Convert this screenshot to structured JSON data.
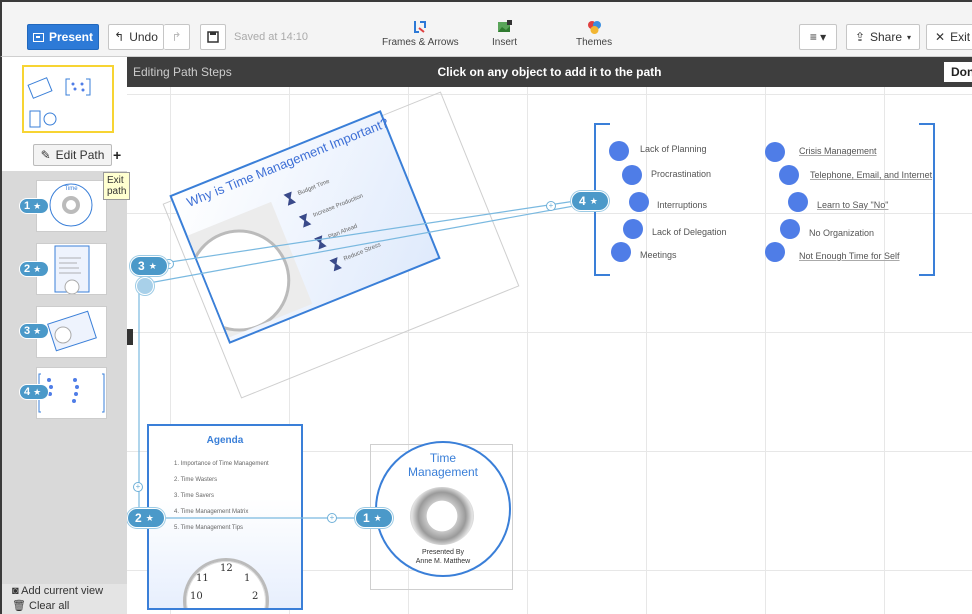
{
  "toolbar": {
    "present_label": "Present",
    "undo_label": "Undo",
    "saved_text": "Saved at 14:10",
    "frames_label": "Frames & Arrows",
    "insert_label": "Insert",
    "themes_label": "Themes",
    "menu_label": "≡ ▾",
    "share_label": "Share",
    "exit_label": "Exit"
  },
  "sidebar": {
    "edit_path_label": "Edit Path",
    "tooltip": "Exit path",
    "thumbnails": [
      {
        "number": "1"
      },
      {
        "number": "2"
      },
      {
        "number": "3"
      },
      {
        "number": "4"
      }
    ],
    "add_view_label": "Add current view",
    "clear_label": "Clear all"
  },
  "pathbar": {
    "left_text": "Editing Path Steps",
    "center_text": "Click on any object to add it to the path",
    "done_label": "Don"
  },
  "slide3": {
    "title": "Why is Time Management Important?",
    "bullets": [
      "Budget Time",
      "Increase Production",
      "Plan Ahead",
      "Reduce Stress"
    ]
  },
  "slide4": {
    "left_items": [
      "Lack of Planning",
      "Procrastination",
      "Interruptions",
      "Lack of Delegation",
      "Meetings"
    ],
    "right_items": [
      "Crisis Management",
      "Telephone, Email, and Internet",
      "Learn to Say \"No\"",
      "No Organization",
      "Not Enough Time for Self"
    ]
  },
  "slide2": {
    "title": "Agenda",
    "items": [
      "1. Importance of Time Management",
      "2. Time Wasters",
      "3. Time Savers",
      "4. Time Management Matrix",
      "5. Time Management Tips"
    ]
  },
  "slide1": {
    "title_line1": "Time",
    "title_line2": "Management",
    "presented_by": "Presented By",
    "author": "Anne M. Matthew"
  },
  "path_badges": [
    {
      "number": "1"
    },
    {
      "number": "2"
    },
    {
      "number": "3"
    },
    {
      "number": "4"
    }
  ],
  "colors": {
    "accent": "#2d7ad7",
    "path": "#4b99c9",
    "frame": "#3a7fd8",
    "dot": "#4f7de7"
  }
}
